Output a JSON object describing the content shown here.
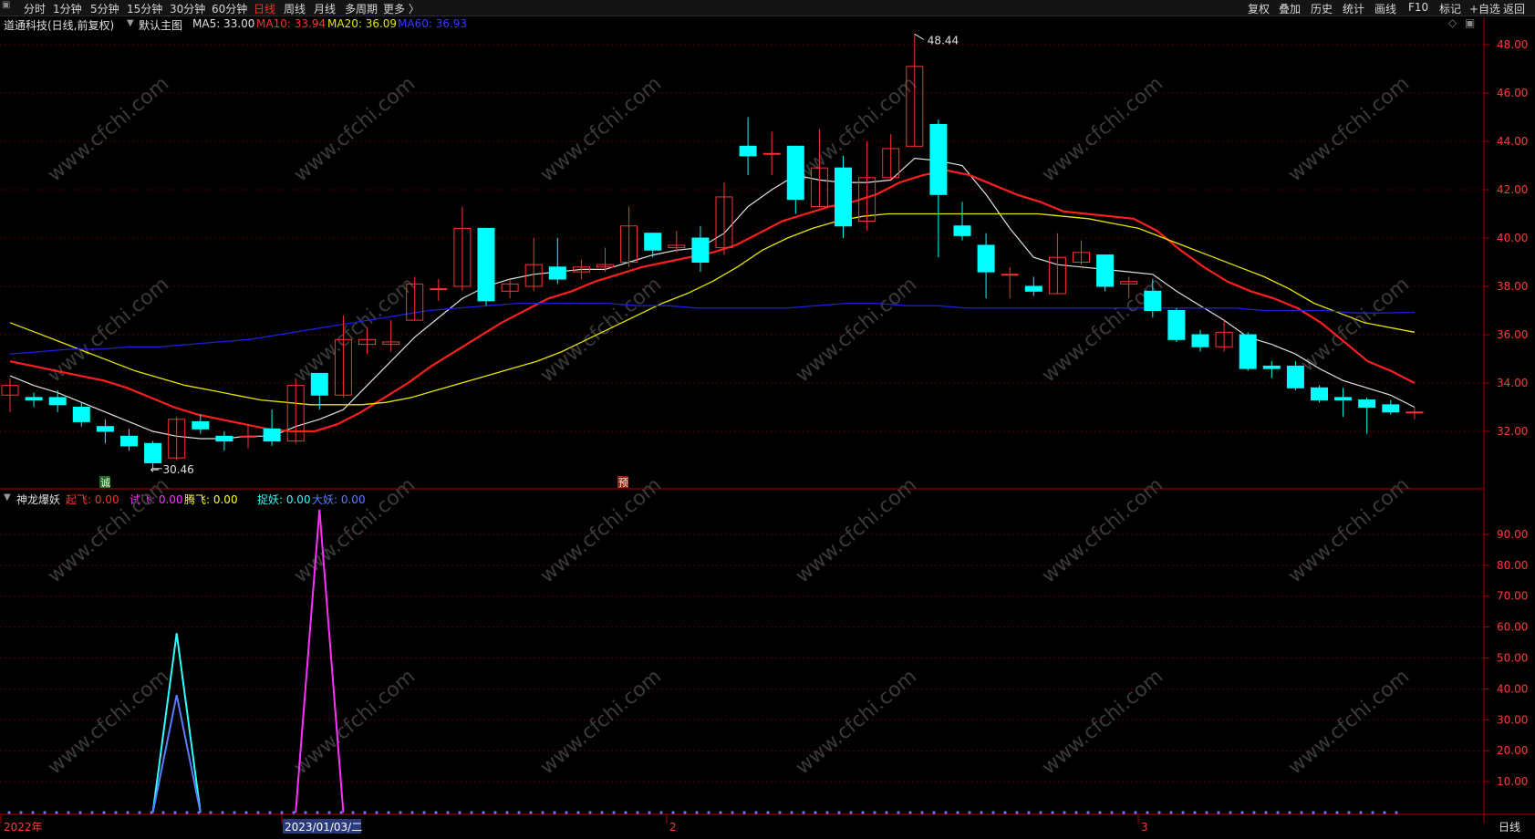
{
  "toolbar": {
    "left_items": [
      "分时",
      "1分钟",
      "5分钟",
      "15分钟",
      "30分钟",
      "60分钟",
      "日线",
      "周线",
      "月线",
      "多周期",
      "更多 〉"
    ],
    "active_index": 6,
    "right_items": [
      "复权",
      "叠加",
      "历史",
      "统计",
      "画线",
      "F10",
      "标记",
      "+自选",
      "返回"
    ]
  },
  "main_info": {
    "title": "道通科技(日线,前复权)",
    "template": "默认主图",
    "ma5": "MA5: 33.00",
    "ma10": "MA10: 33.94",
    "ma20": "MA20: 36.09",
    "ma60": "MA60: 36.93"
  },
  "indicator_info": {
    "name": "神龙爆妖",
    "items": [
      {
        "label": "起飞: 0.00",
        "color": "#ff3030"
      },
      {
        "label": "试飞: 0.00",
        "color": "#ff30ff"
      },
      {
        "label": "腾飞: 0.00",
        "color": "#ffff00"
      },
      {
        "label": "捉妖: 0.00",
        "color": "#30ffff"
      },
      {
        "label": "大妖: 0.00",
        "color": "#5a7dff"
      }
    ]
  },
  "price_axis": [
    "48.00",
    "46.00",
    "44.00",
    "42.00",
    "40.00",
    "38.00",
    "36.00",
    "34.00",
    "32.00"
  ],
  "indicator_axis": [
    "90.00",
    "80.00",
    "70.00",
    "60.00",
    "50.00",
    "40.00",
    "30.00",
    "20.00",
    "10.00"
  ],
  "annotations": {
    "high": "48.44",
    "low": "30.46",
    "mark1": "诚",
    "mark2": "预"
  },
  "date_axis": {
    "labels": [
      "2022年",
      "2023/01/03/二",
      "2",
      "3"
    ],
    "period": "日线"
  },
  "watermark": "www.cfchi.com",
  "colors": {
    "up": "#ff3232",
    "down": "#00ffff",
    "ma5": "#e0e0e0",
    "ma10": "#ff1e1e",
    "ma20": "#e6e600",
    "ma60": "#1e1edc",
    "grid": "#5a0000"
  },
  "chart_data": [
    {
      "type": "candlestick",
      "title": "道通科技(日线,前复权)",
      "ylim": [
        30,
        49
      ],
      "candles": [
        {
          "o": 33.5,
          "c": 33.9,
          "h": 34.2,
          "l": 32.8
        },
        {
          "o": 33.4,
          "c": 33.3,
          "h": 33.6,
          "l": 33.0
        },
        {
          "o": 33.4,
          "c": 33.1,
          "h": 33.7,
          "l": 32.8
        },
        {
          "o": 33.0,
          "c": 32.4,
          "h": 33.2,
          "l": 32.2
        },
        {
          "o": 32.2,
          "c": 32.0,
          "h": 32.5,
          "l": 31.5
        },
        {
          "o": 31.8,
          "c": 31.4,
          "h": 32.1,
          "l": 31.2
        },
        {
          "o": 31.5,
          "c": 30.7,
          "h": 31.6,
          "l": 30.46
        },
        {
          "o": 30.9,
          "c": 32.5,
          "h": 32.6,
          "l": 30.8
        },
        {
          "o": 32.4,
          "c": 32.1,
          "h": 32.7,
          "l": 31.9
        },
        {
          "o": 31.8,
          "c": 31.6,
          "h": 32.0,
          "l": 31.2
        },
        {
          "o": 31.8,
          "c": 31.8,
          "h": 32.3,
          "l": 31.3
        },
        {
          "o": 32.1,
          "c": 31.6,
          "h": 32.9,
          "l": 31.4
        },
        {
          "o": 31.6,
          "c": 33.9,
          "h": 34.2,
          "l": 31.5
        },
        {
          "o": 34.4,
          "c": 33.5,
          "h": 34.4,
          "l": 32.9
        },
        {
          "o": 33.5,
          "c": 35.8,
          "h": 36.8,
          "l": 33.4
        },
        {
          "o": 35.6,
          "c": 35.8,
          "h": 36.3,
          "l": 35.2
        },
        {
          "o": 35.6,
          "c": 35.7,
          "h": 36.6,
          "l": 35.3
        },
        {
          "o": 36.6,
          "c": 38.1,
          "h": 38.4,
          "l": 36.6
        },
        {
          "o": 37.9,
          "c": 37.9,
          "h": 38.3,
          "l": 37.4
        },
        {
          "o": 38.0,
          "c": 40.4,
          "h": 41.3,
          "l": 37.8
        },
        {
          "o": 40.4,
          "c": 37.4,
          "h": 40.4,
          "l": 37.2
        },
        {
          "o": 37.8,
          "c": 38.1,
          "h": 38.3,
          "l": 37.5
        },
        {
          "o": 38.0,
          "c": 38.9,
          "h": 40.0,
          "l": 37.8
        },
        {
          "o": 38.8,
          "c": 38.3,
          "h": 40.0,
          "l": 38.1
        },
        {
          "o": 38.6,
          "c": 38.8,
          "h": 39.1,
          "l": 38.3
        },
        {
          "o": 38.8,
          "c": 38.9,
          "h": 39.6,
          "l": 38.6
        },
        {
          "o": 39.0,
          "c": 40.5,
          "h": 41.3,
          "l": 38.8
        },
        {
          "o": 40.2,
          "c": 39.5,
          "h": 40.2,
          "l": 39.2
        },
        {
          "o": 39.6,
          "c": 39.7,
          "h": 40.3,
          "l": 39.4
        },
        {
          "o": 40.0,
          "c": 39.0,
          "h": 40.5,
          "l": 38.6
        },
        {
          "o": 39.6,
          "c": 41.7,
          "h": 42.3,
          "l": 39.3
        },
        {
          "o": 43.8,
          "c": 43.4,
          "h": 45.0,
          "l": 42.6
        },
        {
          "o": 43.5,
          "c": 43.5,
          "h": 44.4,
          "l": 42.6
        },
        {
          "o": 43.8,
          "c": 41.6,
          "h": 43.8,
          "l": 41.0
        },
        {
          "o": 41.3,
          "c": 42.9,
          "h": 44.5,
          "l": 41.3
        },
        {
          "o": 42.9,
          "c": 40.5,
          "h": 43.4,
          "l": 40.0
        },
        {
          "o": 40.7,
          "c": 42.5,
          "h": 44.0,
          "l": 40.3
        },
        {
          "o": 42.5,
          "c": 43.7,
          "h": 44.3,
          "l": 42.4
        },
        {
          "o": 43.8,
          "c": 47.1,
          "h": 48.44,
          "l": 43.8
        },
        {
          "o": 44.7,
          "c": 41.8,
          "h": 44.9,
          "l": 39.2
        },
        {
          "o": 40.5,
          "c": 40.1,
          "h": 41.5,
          "l": 39.9
        },
        {
          "o": 39.7,
          "c": 38.6,
          "h": 40.2,
          "l": 37.5
        },
        {
          "o": 38.5,
          "c": 38.5,
          "h": 38.8,
          "l": 37.5
        },
        {
          "o": 38.0,
          "c": 37.8,
          "h": 38.4,
          "l": 37.6
        },
        {
          "o": 37.7,
          "c": 39.2,
          "h": 40.2,
          "l": 37.7
        },
        {
          "o": 39.0,
          "c": 39.4,
          "h": 39.9,
          "l": 38.9
        },
        {
          "o": 39.3,
          "c": 38.0,
          "h": 39.3,
          "l": 37.8
        },
        {
          "o": 38.1,
          "c": 38.2,
          "h": 38.4,
          "l": 37.5
        },
        {
          "o": 37.8,
          "c": 37.0,
          "h": 38.3,
          "l": 36.7
        },
        {
          "o": 37.0,
          "c": 35.8,
          "h": 37.1,
          "l": 35.7
        },
        {
          "o": 36.0,
          "c": 35.5,
          "h": 36.2,
          "l": 35.3
        },
        {
          "o": 35.5,
          "c": 36.1,
          "h": 36.6,
          "l": 35.3
        },
        {
          "o": 36.0,
          "c": 34.6,
          "h": 36.1,
          "l": 34.5
        },
        {
          "o": 34.7,
          "c": 34.6,
          "h": 34.9,
          "l": 34.2
        },
        {
          "o": 34.7,
          "c": 33.8,
          "h": 34.9,
          "l": 33.7
        },
        {
          "o": 33.8,
          "c": 33.3,
          "h": 33.9,
          "l": 33.2
        },
        {
          "o": 33.4,
          "c": 33.3,
          "h": 33.8,
          "l": 32.6
        },
        {
          "o": 33.3,
          "c": 33.0,
          "h": 33.4,
          "l": 31.9
        },
        {
          "o": 33.1,
          "c": 32.8,
          "h": 33.3,
          "l": 32.7
        },
        {
          "o": 32.8,
          "c": 32.8,
          "h": 33.0,
          "l": 32.5
        }
      ],
      "series": [
        {
          "name": "MA5",
          "values": [
            34.3,
            33.9,
            33.6,
            33.2,
            32.8,
            32.4,
            32.0,
            31.8,
            31.7,
            31.7,
            31.8,
            31.8,
            32.2,
            32.5,
            32.9,
            33.9,
            34.9,
            35.9,
            36.7,
            37.5,
            38.0,
            38.3,
            38.5,
            38.6,
            38.7,
            38.7,
            39.0,
            39.3,
            39.5,
            39.6,
            40.2,
            41.3,
            42.0,
            42.6,
            42.4,
            42.3,
            42.3,
            42.4,
            43.3,
            43.2,
            43.0,
            41.8,
            40.4,
            39.2,
            38.9,
            38.8,
            38.7,
            38.6,
            38.5,
            37.8,
            37.2,
            36.6,
            35.9,
            35.6,
            35.2,
            34.6,
            34.1,
            33.8,
            33.5,
            33.0
          ]
        },
        {
          "name": "MA10",
          "values": [
            34.9,
            34.7,
            34.5,
            34.3,
            34.1,
            33.8,
            33.4,
            33.0,
            32.7,
            32.5,
            32.3,
            32.1,
            32.0,
            32.0,
            32.3,
            32.8,
            33.4,
            34.0,
            34.7,
            35.3,
            35.9,
            36.5,
            37.0,
            37.5,
            37.8,
            38.2,
            38.5,
            38.8,
            39.0,
            39.2,
            39.4,
            39.7,
            40.2,
            40.7,
            41.0,
            41.3,
            41.5,
            41.8,
            42.3,
            42.6,
            42.8,
            42.6,
            42.2,
            41.8,
            41.5,
            41.1,
            41.0,
            40.9,
            40.8,
            40.3,
            39.5,
            38.8,
            38.2,
            37.8,
            37.5,
            37.1,
            36.5,
            35.7,
            34.9,
            34.5,
            34.0
          ]
        },
        {
          "name": "MA20",
          "values": [
            36.5,
            36.1,
            35.7,
            35.3,
            34.9,
            34.5,
            34.2,
            33.9,
            33.7,
            33.5,
            33.3,
            33.2,
            33.1,
            33.1,
            33.1,
            33.2,
            33.4,
            33.7,
            34.0,
            34.3,
            34.6,
            34.9,
            35.3,
            35.8,
            36.3,
            36.8,
            37.3,
            37.7,
            38.2,
            38.8,
            39.5,
            40.0,
            40.4,
            40.7,
            40.9,
            41.0,
            41.0,
            41.0,
            41.0,
            41.0,
            41.0,
            41.0,
            40.9,
            40.8,
            40.6,
            40.4,
            40.0,
            39.6,
            39.2,
            38.8,
            38.4,
            37.9,
            37.3,
            36.9,
            36.5,
            36.3,
            36.1
          ]
        },
        {
          "name": "MA60",
          "values": [
            35.2,
            35.3,
            35.4,
            35.4,
            35.5,
            35.5,
            35.6,
            35.7,
            35.8,
            36.0,
            36.2,
            36.4,
            36.6,
            36.8,
            37.0,
            37.1,
            37.2,
            37.3,
            37.3,
            37.3,
            37.3,
            37.2,
            37.2,
            37.1,
            37.1,
            37.1,
            37.1,
            37.2,
            37.3,
            37.3,
            37.2,
            37.2,
            37.1,
            37.1,
            37.1,
            37.1,
            37.1,
            37.1,
            37.1,
            37.1,
            37.1,
            37.1,
            37.0,
            37.0,
            37.0,
            36.9,
            36.9,
            36.93
          ]
        }
      ]
    },
    {
      "type": "line",
      "title": "神龙爆妖",
      "ylim": [
        0,
        100
      ],
      "series": [
        {
          "name": "捉妖",
          "values": [
            {
              "i": 6,
              "v": 0
            },
            {
              "i": 7,
              "v": 58
            },
            {
              "i": 8,
              "v": 0
            }
          ]
        },
        {
          "name": "大妖",
          "values": [
            {
              "i": 6,
              "v": 0
            },
            {
              "i": 7,
              "v": 38
            },
            {
              "i": 8,
              "v": 0
            }
          ]
        },
        {
          "name": "试飞",
          "values": [
            {
              "i": 12,
              "v": 0
            },
            {
              "i": 13,
              "v": 98
            },
            {
              "i": 14,
              "v": 0
            }
          ]
        }
      ]
    }
  ]
}
